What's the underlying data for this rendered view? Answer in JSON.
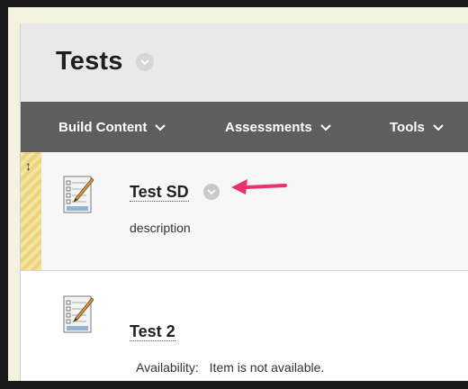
{
  "header": {
    "title": "Tests"
  },
  "toolbar": {
    "items": [
      {
        "label": "Build Content"
      },
      {
        "label": "Assessments"
      },
      {
        "label": "Tools"
      }
    ]
  },
  "content_items": [
    {
      "title": "Test SD",
      "description": "description",
      "drag_glyph": "↕"
    },
    {
      "title": "Test 2",
      "availability_label": "Availability:",
      "availability_value": "Item is not available."
    }
  ],
  "annotation": {
    "arrow_color": "#e8336b"
  },
  "icons": {
    "title_chevron": "chevron-down-icon",
    "item_icon": "test-pencil-icon",
    "drag": "drag-handle-icon"
  }
}
